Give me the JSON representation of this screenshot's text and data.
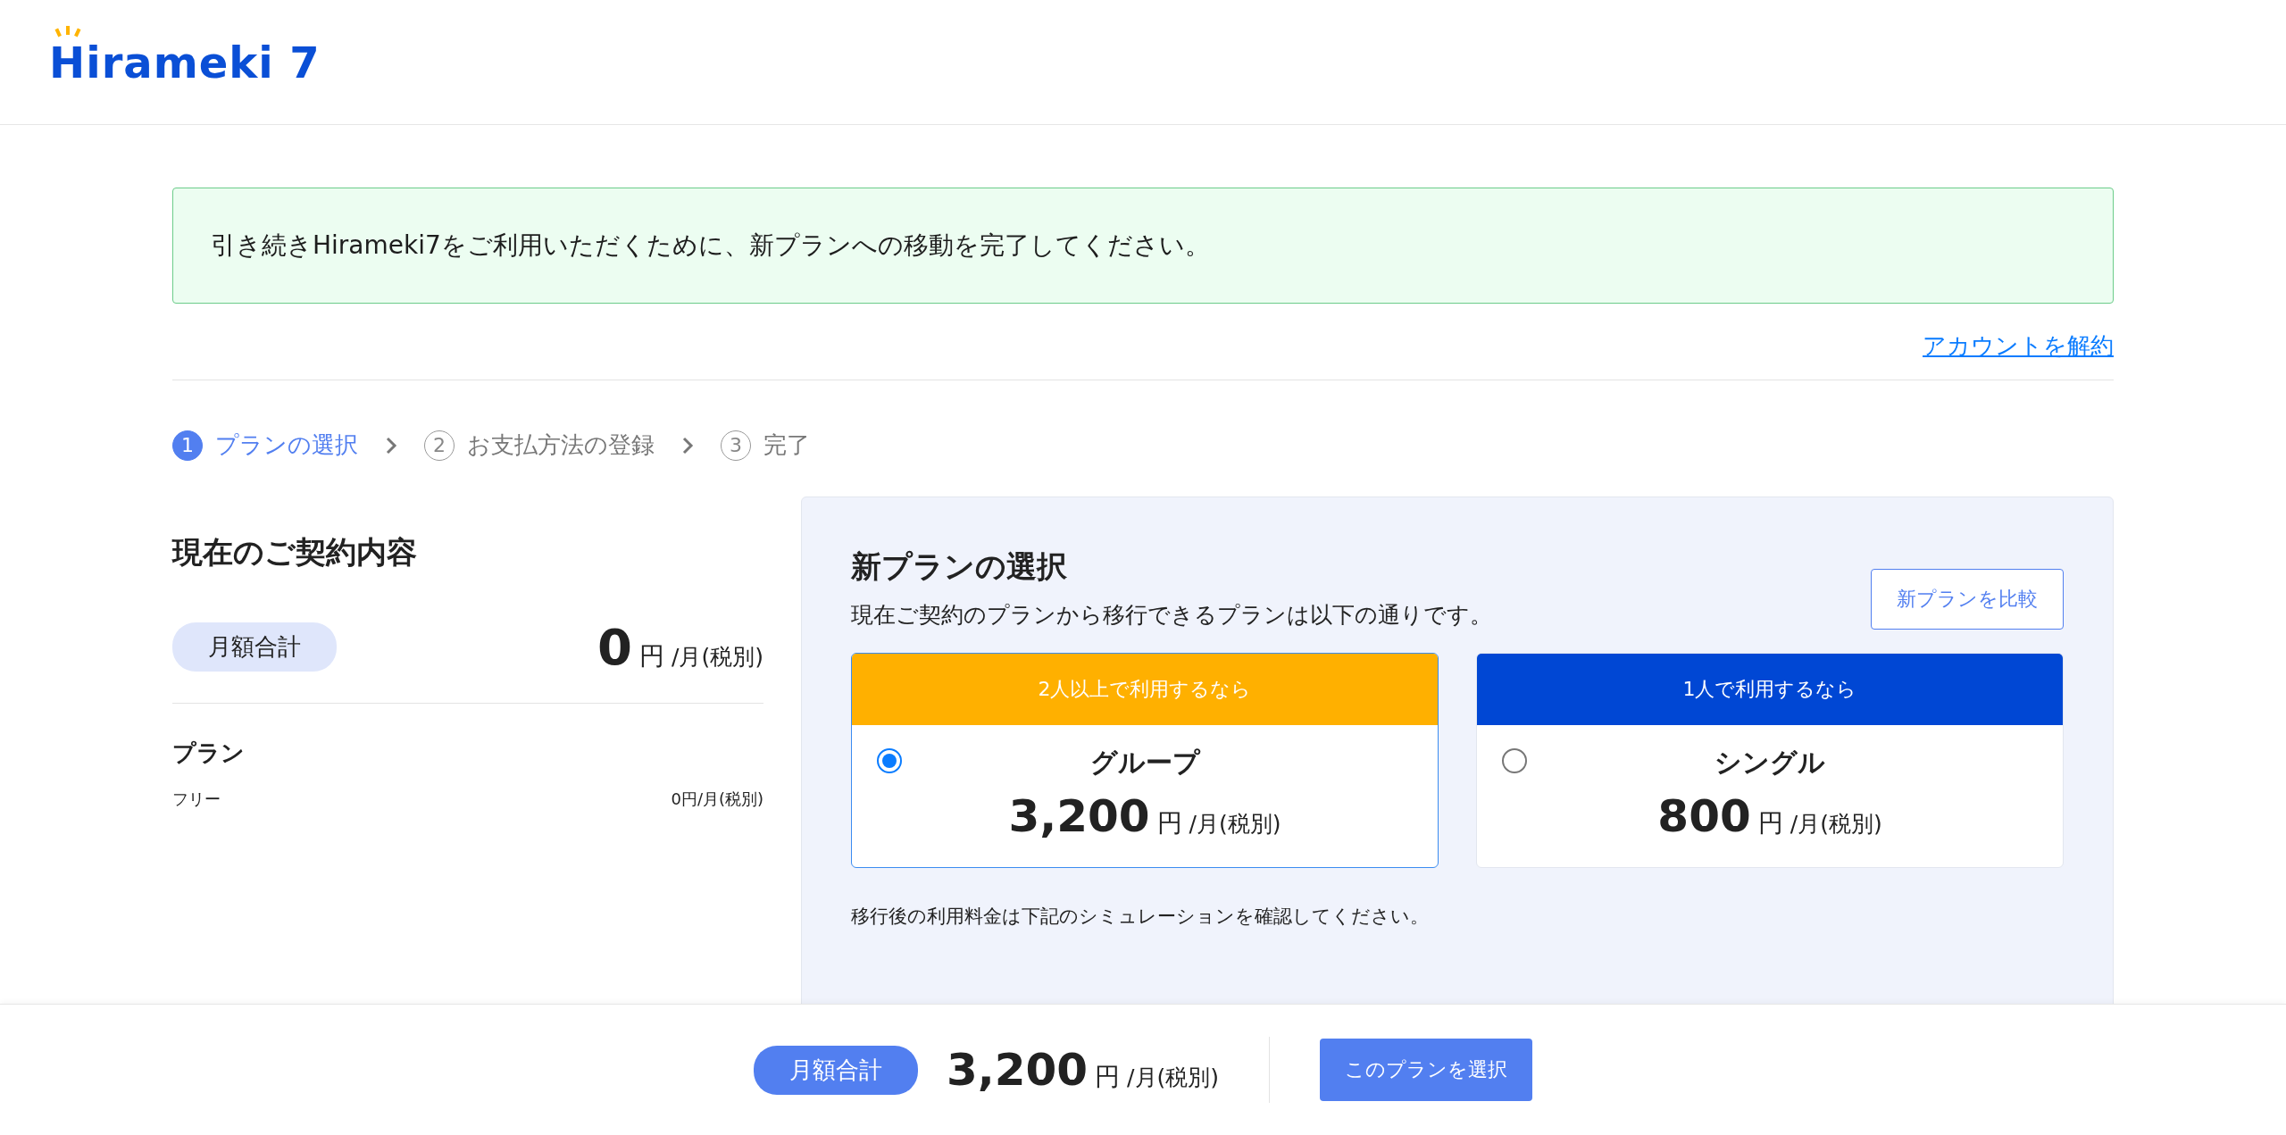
{
  "header": {
    "logo": "Hirameki 7"
  },
  "notice": {
    "text": "引き続きHirameki7をご利用いただくために、新プランへの移動を完了してください。"
  },
  "cancel_link": "アカウントを解約",
  "steps": [
    {
      "number": "1",
      "label": "プランの選択",
      "selected": true
    },
    {
      "number": "2",
      "label": "お支払方法の登録",
      "selected": false
    },
    {
      "number": "3",
      "label": "完了",
      "selected": false
    }
  ],
  "current_contract": {
    "title": "現在のご契約内容",
    "total_label": "月額合計",
    "amount": "0",
    "unit": "円",
    "period": "/月(税別)",
    "plan_heading": "プラン",
    "plan_name": "フリー",
    "plan_price": "0円/月(税別)"
  },
  "new_plan": {
    "title": "新プランの選択",
    "subtitle": "現在ご契約のプランから移行できるプランは以下の通りです。",
    "compare_button": "新プランを比較",
    "plans": [
      {
        "header": "2人以上で利用するなら",
        "color": "#ffb000",
        "name": "グループ",
        "price": "3,200",
        "unit": "円",
        "period": "/月(税別)",
        "selected": true
      },
      {
        "header": "1人で利用するなら",
        "color": "#0047d4",
        "name": "シングル",
        "price": "800",
        "unit": "円",
        "period": "/月(税別)",
        "selected": false
      }
    ],
    "note": "移行後の利用料金は下記のシミュレーションを確認してください。"
  },
  "footer": {
    "total_label": "月額合計",
    "amount": "3,200",
    "unit": "円",
    "period": "/月(税別)",
    "button": "このプランを選択"
  }
}
